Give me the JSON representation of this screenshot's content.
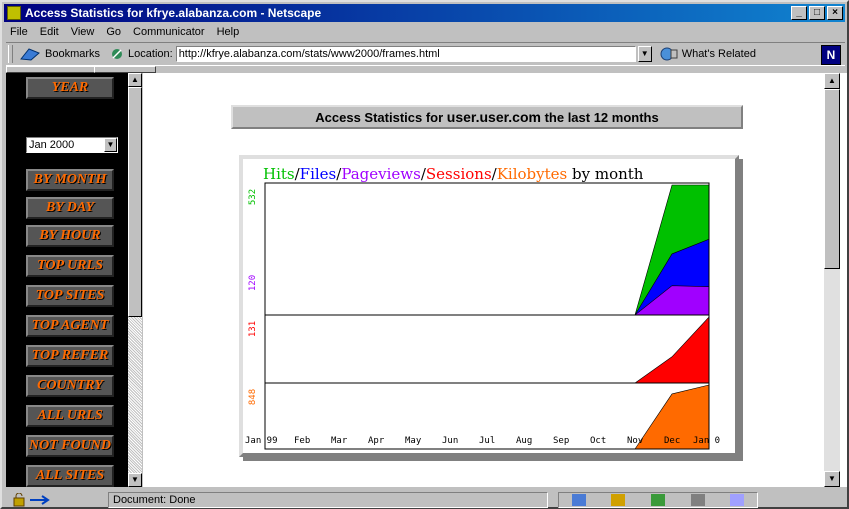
{
  "window": {
    "title": "Access Statistics for kfrye.alabanza.com - Netscape"
  },
  "menu": [
    "File",
    "Edit",
    "View",
    "Go",
    "Communicator",
    "Help"
  ],
  "toolbar": {
    "bookmarks_label": "Bookmarks",
    "location_label": "Location:",
    "url": "http://kfrye.alabanza.com/stats/www2000/frames.html",
    "whats_related_label": "What's Related",
    "netscape_logo": "N"
  },
  "sidebar": {
    "year_button": "YEAR",
    "selected_month": "Jan 2000",
    "buttons": [
      "BY MONTH",
      "BY DAY",
      "BY HOUR",
      "TOP URLS",
      "TOP SITES",
      "TOP AGENT",
      "TOP REFER",
      "COUNTRY",
      "ALL URLS",
      "NOT FOUND",
      "ALL SITES"
    ]
  },
  "banner": {
    "prefix": "Access Statistics for ",
    "site": "user.user.com",
    "suffix": " the last 12 months"
  },
  "status": {
    "text": "Document: Done"
  },
  "colors": {
    "hits": "#00c000",
    "files": "#0000ff",
    "pageviews": "#a000ff",
    "sessions": "#ff0000",
    "kilobytes": "#ff6a00"
  },
  "chart_data": {
    "type": "area",
    "title_parts": [
      {
        "text": "Hits",
        "color": "#00c000"
      },
      {
        "text": "/",
        "color": "#000000"
      },
      {
        "text": "Files",
        "color": "#0000ff"
      },
      {
        "text": "/",
        "color": "#000000"
      },
      {
        "text": "Pageviews",
        "color": "#a000ff"
      },
      {
        "text": "/",
        "color": "#000000"
      },
      {
        "text": "Sessions",
        "color": "#ff0000"
      },
      {
        "text": "/",
        "color": "#000000"
      },
      {
        "text": "Kilobytes",
        "color": "#ff6a00"
      },
      {
        "text": " by month",
        "color": "#000000"
      }
    ],
    "categories": [
      "Jan 99",
      "Feb",
      "Mar",
      "Apr",
      "May",
      "Jun",
      "Jul",
      "Aug",
      "Sep",
      "Oct",
      "Nov",
      "Dec",
      "Jan 0"
    ],
    "panels": [
      {
        "name": "hits-files-pageviews",
        "max_label": "532",
        "mid_label": "120",
        "max_label_color": "#00c000",
        "mid_label_color": "#a000ff",
        "series": [
          {
            "name": "Hits",
            "color": "#00c000",
            "values": [
              0,
              0,
              0,
              0,
              0,
              0,
              0,
              0,
              0,
              0,
              0,
              532,
              532
            ]
          },
          {
            "name": "Files",
            "color": "#0000ff",
            "values": [
              0,
              0,
              0,
              0,
              0,
              0,
              0,
              0,
              0,
              0,
              0,
              250,
              310
            ]
          },
          {
            "name": "Pageviews",
            "color": "#a000ff",
            "values": [
              0,
              0,
              0,
              0,
              0,
              0,
              0,
              0,
              0,
              0,
              0,
              120,
              116
            ]
          }
        ],
        "ymax": 532
      },
      {
        "name": "sessions",
        "max_label": "131",
        "max_label_color": "#ff0000",
        "series": [
          {
            "name": "Sessions",
            "color": "#ff0000",
            "values": [
              0,
              0,
              0,
              0,
              0,
              0,
              0,
              0,
              0,
              0,
              0,
              52,
              131
            ]
          }
        ],
        "ymax": 131
      },
      {
        "name": "kilobytes",
        "max_label": "848",
        "max_label_color": "#ff6a00",
        "series": [
          {
            "name": "Kilobytes",
            "color": "#ff6a00",
            "values": [
              0,
              0,
              0,
              0,
              0,
              0,
              0,
              0,
              0,
              0,
              0,
              730,
              848
            ]
          }
        ],
        "ymax": 848
      }
    ]
  }
}
